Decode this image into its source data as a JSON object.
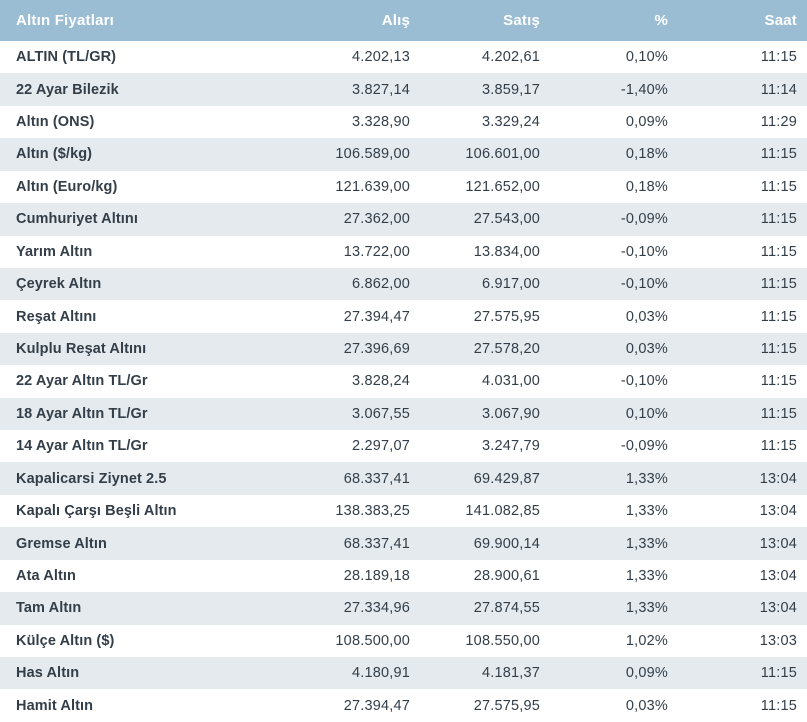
{
  "colors": {
    "header_bg": "#9bbdd4",
    "header_text": "#ffffff",
    "row_bg": "#ffffff",
    "row_alt_bg": "#e4eaee",
    "text": "#333e48"
  },
  "table": {
    "header": {
      "name": "Altın Fiyatları",
      "buy": "Alış",
      "sell": "Satış",
      "percent": "%",
      "time": "Saat"
    },
    "rows": [
      {
        "name": "ALTIN (TL/GR)",
        "buy": "4.202,13",
        "sell": "4.202,61",
        "percent": "0,10%",
        "time": "11:15"
      },
      {
        "name": "22 Ayar Bilezik",
        "buy": "3.827,14",
        "sell": "3.859,17",
        "percent": "-1,40%",
        "time": "11:14"
      },
      {
        "name": "Altın (ONS)",
        "buy": "3.328,90",
        "sell": "3.329,24",
        "percent": "0,09%",
        "time": "11:29"
      },
      {
        "name": "Altın ($/kg)",
        "buy": "106.589,00",
        "sell": "106.601,00",
        "percent": "0,18%",
        "time": "11:15"
      },
      {
        "name": "Altın (Euro/kg)",
        "buy": "121.639,00",
        "sell": "121.652,00",
        "percent": "0,18%",
        "time": "11:15"
      },
      {
        "name": "Cumhuriyet Altını",
        "buy": "27.362,00",
        "sell": "27.543,00",
        "percent": "-0,09%",
        "time": "11:15"
      },
      {
        "name": "Yarım Altın",
        "buy": "13.722,00",
        "sell": "13.834,00",
        "percent": "-0,10%",
        "time": "11:15"
      },
      {
        "name": "Çeyrek Altın",
        "buy": "6.862,00",
        "sell": "6.917,00",
        "percent": "-0,10%",
        "time": "11:15"
      },
      {
        "name": "Reşat Altını",
        "buy": "27.394,47",
        "sell": "27.575,95",
        "percent": "0,03%",
        "time": "11:15"
      },
      {
        "name": "Kulplu Reşat Altını",
        "buy": "27.396,69",
        "sell": "27.578,20",
        "percent": "0,03%",
        "time": "11:15"
      },
      {
        "name": "22 Ayar Altın TL/Gr",
        "buy": "3.828,24",
        "sell": "4.031,00",
        "percent": "-0,10%",
        "time": "11:15"
      },
      {
        "name": "18 Ayar Altın TL/Gr",
        "buy": "3.067,55",
        "sell": "3.067,90",
        "percent": "0,10%",
        "time": "11:15"
      },
      {
        "name": "14 Ayar Altın TL/Gr",
        "buy": "2.297,07",
        "sell": "3.247,79",
        "percent": "-0,09%",
        "time": "11:15"
      },
      {
        "name": "Kapalicarsi Ziynet 2.5",
        "buy": "68.337,41",
        "sell": "69.429,87",
        "percent": "1,33%",
        "time": "13:04"
      },
      {
        "name": "Kapalı Çarşı Beşli Altın",
        "buy": "138.383,25",
        "sell": "141.082,85",
        "percent": "1,33%",
        "time": "13:04"
      },
      {
        "name": "Gremse Altın",
        "buy": "68.337,41",
        "sell": "69.900,14",
        "percent": "1,33%",
        "time": "13:04"
      },
      {
        "name": "Ata Altın",
        "buy": "28.189,18",
        "sell": "28.900,61",
        "percent": "1,33%",
        "time": "13:04"
      },
      {
        "name": "Tam Altın",
        "buy": "27.334,96",
        "sell": "27.874,55",
        "percent": "1,33%",
        "time": "13:04"
      },
      {
        "name": "Külçe Altın ($)",
        "buy": "108.500,00",
        "sell": "108.550,00",
        "percent": "1,02%",
        "time": "13:03"
      },
      {
        "name": "Has Altın",
        "buy": "4.180,91",
        "sell": "4.181,37",
        "percent": "0,09%",
        "time": "11:15"
      },
      {
        "name": "Hamit Altın",
        "buy": "27.394,47",
        "sell": "27.575,95",
        "percent": "0,03%",
        "time": "11:15"
      }
    ]
  }
}
